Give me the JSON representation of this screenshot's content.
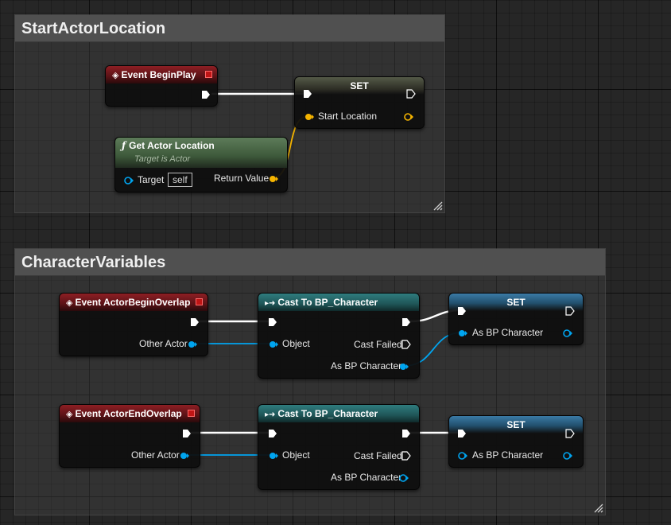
{
  "comments": [
    {
      "title": "StartActorLocation"
    },
    {
      "title": "CharacterVariables"
    }
  ],
  "nodes": {
    "begin_play": {
      "title": "Event BeginPlay"
    },
    "set_start": {
      "title": "SET",
      "var": "Start Location"
    },
    "get_actor_location": {
      "title": "Get Actor Location",
      "subtitle": "Target is Actor",
      "target_label": "Target",
      "target_default": "self",
      "return_label": "Return Value"
    },
    "begin_overlap": {
      "title": "Event ActorBeginOverlap",
      "other_actor": "Other Actor"
    },
    "cast_1": {
      "title": "Cast To BP_Character",
      "object": "Object",
      "cast_failed": "Cast Failed",
      "as_bp": "As BP Character"
    },
    "set_bp_1": {
      "title": "SET",
      "var": "As BP Character"
    },
    "end_overlap": {
      "title": "Event ActorEndOverlap",
      "other_actor": "Other Actor"
    },
    "cast_2": {
      "title": "Cast To BP_Character",
      "object": "Object",
      "cast_failed": "Cast Failed",
      "as_bp": "As BP Character"
    },
    "set_bp_2": {
      "title": "SET",
      "var": "As BP Character"
    }
  },
  "colors": {
    "exec_wire": "#ffffff",
    "vector_pin": "#f5b400",
    "object_pin": "#00a5f0",
    "event_header": "#8e1f24",
    "function_header": "#5d7b59",
    "cast_header": "#2f7c7e"
  }
}
